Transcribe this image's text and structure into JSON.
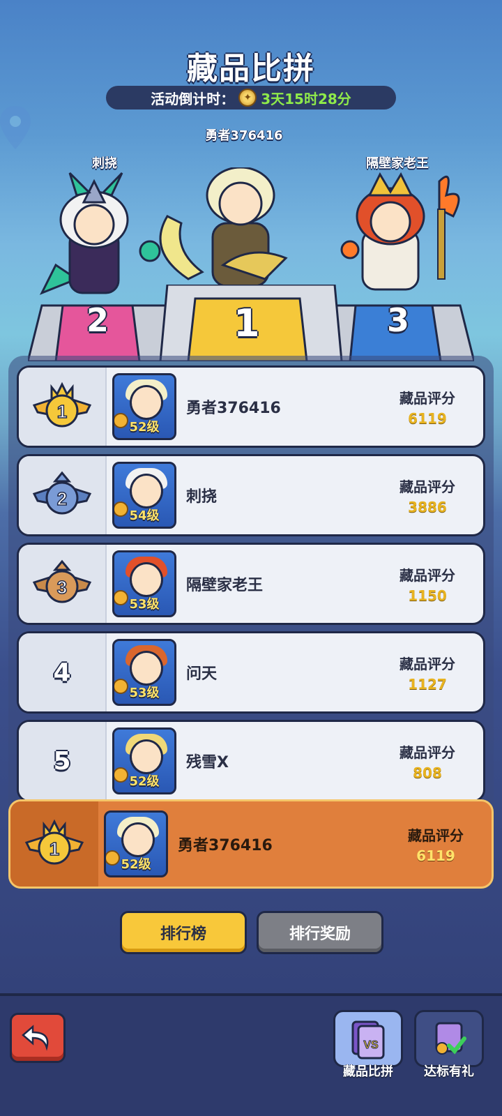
{
  "header": {
    "title": "藏品比拼",
    "countdown_label": "活动倒计时：",
    "countdown_value": "3天15时28分"
  },
  "podium": {
    "first": {
      "name": "勇者376416",
      "rank": "1"
    },
    "second": {
      "name": "刺挠",
      "rank": "2"
    },
    "third": {
      "name": "隔壁家老王",
      "rank": "3"
    }
  },
  "ranking": [
    {
      "rank": "1",
      "name": "勇者376416",
      "level": "52级",
      "score_label": "藏品评分",
      "score": "6119"
    },
    {
      "rank": "2",
      "name": "刺挠",
      "level": "54级",
      "score_label": "藏品评分",
      "score": "3886"
    },
    {
      "rank": "3",
      "name": "隔壁家老王",
      "level": "53级",
      "score_label": "藏品评分",
      "score": "1150"
    },
    {
      "rank": "4",
      "name": "问天",
      "level": "53级",
      "score_label": "藏品评分",
      "score": "1127"
    },
    {
      "rank": "5",
      "name": "残雪X",
      "level": "52级",
      "score_label": "藏品评分",
      "score": "808"
    }
  ],
  "my_rank": {
    "rank": "1",
    "name": "勇者376416",
    "level": "52级",
    "score_label": "藏品评分",
    "score": "6119"
  },
  "buttons": {
    "leaderboard": "排行榜",
    "rewards": "排行奖励"
  },
  "bottom_nav": {
    "collection_compare": "藏品比拼",
    "milestone_gift": "达标有礼"
  },
  "colors": {
    "gold": "#f8c83a",
    "highlight_row": "#e07f3c",
    "back_button": "#e14a3a"
  }
}
